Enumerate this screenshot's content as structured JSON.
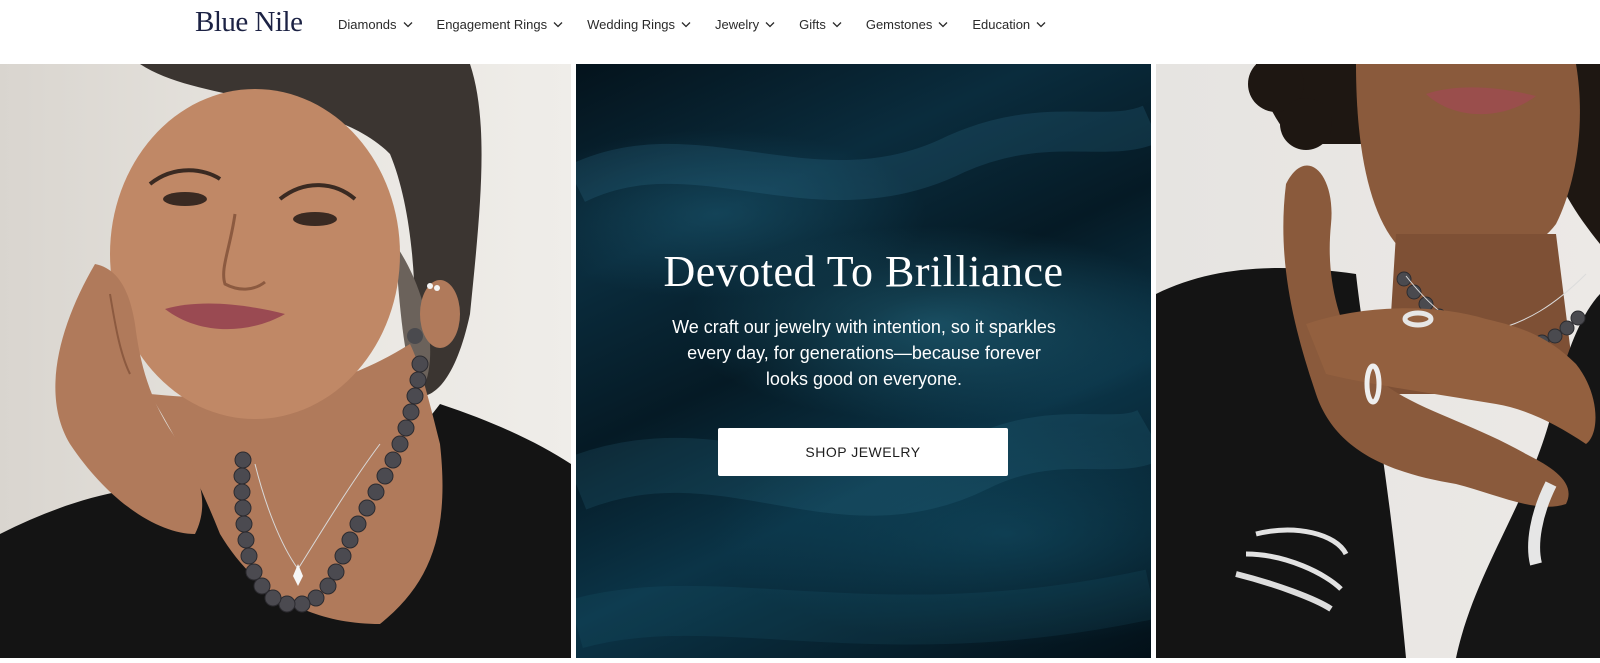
{
  "header": {
    "logo": "Blue Nile",
    "nav": [
      {
        "label": "Diamonds"
      },
      {
        "label": "Engagement Rings"
      },
      {
        "label": "Wedding Rings"
      },
      {
        "label": "Jewelry"
      },
      {
        "label": "Gifts"
      },
      {
        "label": "Gemstones"
      },
      {
        "label": "Education"
      }
    ]
  },
  "hero": {
    "title": "Devoted To Brilliance",
    "text": "We craft our jewelry with intention, so it sparkles every day, for generations—because forever looks good on everyone.",
    "button_label": "SHOP JEWELRY"
  },
  "colors": {
    "brand_navy": "#1c2244",
    "hero_teal": "#0b3447",
    "button_bg": "#ffffff"
  },
  "icons": {
    "nav_chevron": "chevron-down-icon"
  }
}
